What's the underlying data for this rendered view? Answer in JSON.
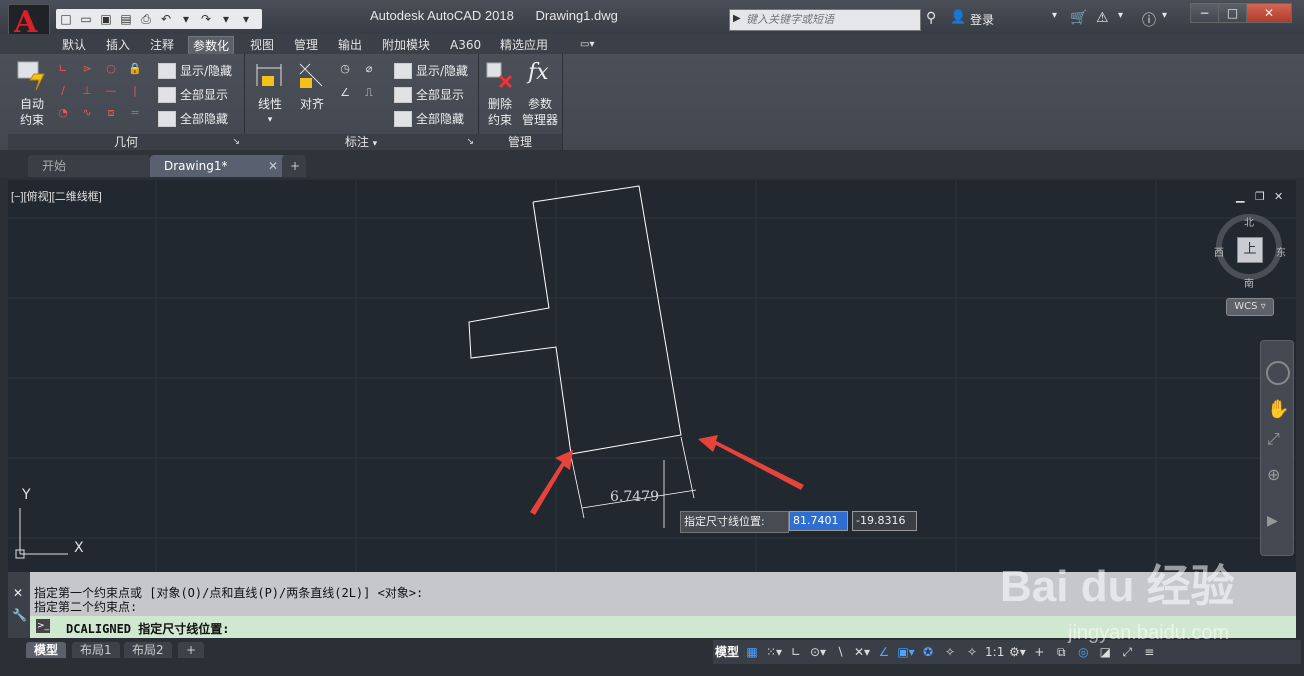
{
  "app": {
    "title": "Autodesk AutoCAD 2018",
    "file": "Drawing1.dwg",
    "logo_letter": "A"
  },
  "search": {
    "placeholder": "键入关键字或短语"
  },
  "account": {
    "login": "登录"
  },
  "ribbon_tabs": [
    "默认",
    "插入",
    "注释",
    "参数化",
    "视图",
    "管理",
    "输出",
    "附加模块",
    "A360",
    "精选应用"
  ],
  "active_tab": "参数化",
  "panels": {
    "geometry": {
      "footer": "几何",
      "auto_constrain_line1": "自动",
      "auto_constrain_line2": "约束",
      "show_hide": "显示/隐藏",
      "show_all": "全部显示",
      "hide_all": "全部隐藏"
    },
    "dimensional": {
      "footer": "标注",
      "linear": "线性",
      "aligned": "对齐",
      "show_hide": "显示/隐藏",
      "show_all": "全部显示",
      "hide_all": "全部隐藏"
    },
    "manage": {
      "footer": "管理",
      "delete_line1": "删除",
      "delete_line2": "约束",
      "params_line1": "参数",
      "params_line2": "管理器"
    }
  },
  "doc_tabs": {
    "start": "开始",
    "drawing": "Drawing1*"
  },
  "viewport": {
    "label": "[−][俯视][二维线框]"
  },
  "viewcube": {
    "north": "北",
    "south": "南",
    "east": "东",
    "west": "西",
    "top": "上",
    "wcs": "WCS"
  },
  "ucs": {
    "x": "X",
    "y": "Y"
  },
  "dimension": {
    "value": "6.7479"
  },
  "tooltip": {
    "label": "指定尺寸线位置:",
    "x_value": "81.7401",
    "y_value": "-19.8316"
  },
  "command": {
    "line1": "指定第一个约束点或 [对象(O)/点和直线(P)/两条直线(2L)] <对象>:",
    "line2": "指定第二个约束点:",
    "current": "DCALIGNED 指定尺寸线位置:"
  },
  "layout_tabs": [
    "模型",
    "布局1",
    "布局2"
  ],
  "status": {
    "model": "模型",
    "scale": "1:1"
  },
  "watermark": {
    "logo": "Bai du 经验",
    "url": "jingyan.baidu.com"
  },
  "colors": {
    "accent_red": "#d6212a",
    "canvas_bg": "#212830",
    "highlight_blue": "#2d6ed0",
    "cmd_green": "#cfe8cf",
    "annotation_arrow": "#e8433a"
  }
}
